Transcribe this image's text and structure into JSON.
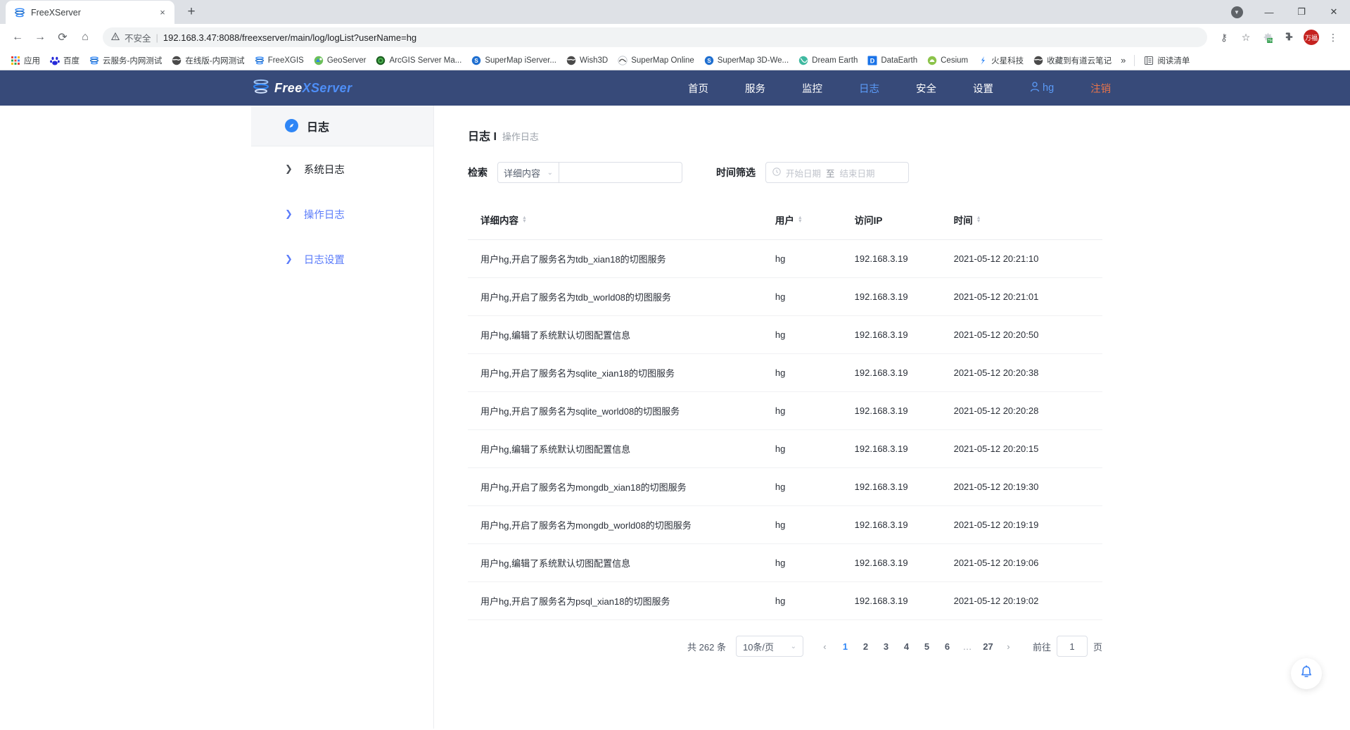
{
  "browser": {
    "tab": {
      "title": "FreeXServer",
      "favicon_name": "freexserver-favicon",
      "close_label": "×"
    },
    "new_tab_label": "+",
    "window_controls": {
      "minimize": "—",
      "maximize": "❐",
      "close": "✕",
      "profile_chevron": "▼"
    },
    "nav": {
      "back": "←",
      "forward": "→",
      "reload": "⟳",
      "home": "⌂"
    },
    "omnibox": {
      "warning_icon": "warning-triangle-icon",
      "security_label": "不安全",
      "separator": "|",
      "url": "192.168.3.47:8088/freexserver/main/log/logList?userName=hg"
    },
    "toolbar_right": {
      "key_icon": "⚷",
      "star_icon": "☆",
      "ext1_icon": "puzzle-ext-icon",
      "ext2_icon": "✦",
      "profile_initials": "万福",
      "menu_icon": "⋮"
    },
    "bookmarks": [
      {
        "label": "应用",
        "icon": "apps-grid-icon"
      },
      {
        "label": "百度",
        "icon": "baidu-icon"
      },
      {
        "label": "云服务-内网测试",
        "icon": "freexserver-icon"
      },
      {
        "label": "在线版-内网测试",
        "icon": "globe-dark-icon"
      },
      {
        "label": "FreeXGIS",
        "icon": "freexserver-icon"
      },
      {
        "label": "GeoServer",
        "icon": "geoserver-icon"
      },
      {
        "label": "ArcGIS Server Ma...",
        "icon": "arcgis-icon"
      },
      {
        "label": "SuperMap iServer...",
        "icon": "supermap-icon"
      },
      {
        "label": "Wish3D",
        "icon": "globe-dark-icon"
      },
      {
        "label": "SuperMap Online",
        "icon": "supermap-online-icon"
      },
      {
        "label": "SuperMap 3D-We...",
        "icon": "supermap-icon"
      },
      {
        "label": "Dream Earth",
        "icon": "dream-earth-icon"
      },
      {
        "label": "DataEarth",
        "icon": "dataearth-icon"
      },
      {
        "label": "Cesium",
        "icon": "cesium-icon"
      },
      {
        "label": "火星科技",
        "icon": "mars-tech-icon"
      },
      {
        "label": "收藏到有道云笔记",
        "icon": "youdao-icon"
      }
    ],
    "bookmarks_overflow": "»",
    "reading_list": {
      "label": "阅读清单",
      "icon": "reading-list-icon"
    }
  },
  "topnav": {
    "logo": {
      "free": "Free",
      "x": "X",
      "server": "Server",
      "icon": "freexserver-logo-icon"
    },
    "items": [
      {
        "label": "首页",
        "state": "normal"
      },
      {
        "label": "服务",
        "state": "normal"
      },
      {
        "label": "监控",
        "state": "normal"
      },
      {
        "label": "日志",
        "state": "active"
      },
      {
        "label": "安全",
        "state": "normal"
      },
      {
        "label": "设置",
        "state": "normal"
      }
    ],
    "user": {
      "label": "hg",
      "icon": "user-person-icon"
    },
    "logout": {
      "label": "注销"
    }
  },
  "sidebar": {
    "header": {
      "label": "日志",
      "icon": "compass-check-icon"
    },
    "items": [
      {
        "label": "系统日志",
        "state": "normal",
        "chevron": "❯"
      },
      {
        "label": "操作日志",
        "state": "link",
        "chevron": "❯"
      },
      {
        "label": "日志设置",
        "state": "link",
        "chevron": "❯"
      }
    ]
  },
  "content": {
    "breadcrumb": {
      "main": "日志 I",
      "sub": "操作日志"
    },
    "filters": {
      "search_label": "检索",
      "select_value": "详细内容",
      "select_chevron": "⌄",
      "search_value": "",
      "search_placeholder": "",
      "time_label": "时间筛选",
      "clock_icon": "clock-icon",
      "date_start_placeholder": "开始日期",
      "date_separator": "至",
      "date_end_placeholder": "结束日期"
    },
    "table": {
      "columns": [
        {
          "label": "详细内容",
          "sortable": true
        },
        {
          "label": "用户",
          "sortable": true
        },
        {
          "label": "访问IP",
          "sortable": false
        },
        {
          "label": "时间",
          "sortable": true
        }
      ],
      "rows": [
        {
          "detail": "用户hg,开启了服务名为tdb_xian18的切图服务",
          "user": "hg",
          "ip": "192.168.3.19",
          "time": "2021-05-12 20:21:10"
        },
        {
          "detail": "用户hg,开启了服务名为tdb_world08的切图服务",
          "user": "hg",
          "ip": "192.168.3.19",
          "time": "2021-05-12 20:21:01"
        },
        {
          "detail": "用户hg,编辑了系统默认切图配置信息",
          "user": "hg",
          "ip": "192.168.3.19",
          "time": "2021-05-12 20:20:50"
        },
        {
          "detail": "用户hg,开启了服务名为sqlite_xian18的切图服务",
          "user": "hg",
          "ip": "192.168.3.19",
          "time": "2021-05-12 20:20:38"
        },
        {
          "detail": "用户hg,开启了服务名为sqlite_world08的切图服务",
          "user": "hg",
          "ip": "192.168.3.19",
          "time": "2021-05-12 20:20:28"
        },
        {
          "detail": "用户hg,编辑了系统默认切图配置信息",
          "user": "hg",
          "ip": "192.168.3.19",
          "time": "2021-05-12 20:20:15"
        },
        {
          "detail": "用户hg,开启了服务名为mongdb_xian18的切图服务",
          "user": "hg",
          "ip": "192.168.3.19",
          "time": "2021-05-12 20:19:30"
        },
        {
          "detail": "用户hg,开启了服务名为mongdb_world08的切图服务",
          "user": "hg",
          "ip": "192.168.3.19",
          "time": "2021-05-12 20:19:19"
        },
        {
          "detail": "用户hg,编辑了系统默认切图配置信息",
          "user": "hg",
          "ip": "192.168.3.19",
          "time": "2021-05-12 20:19:06"
        },
        {
          "detail": "用户hg,开启了服务名为psql_xian18的切图服务",
          "user": "hg",
          "ip": "192.168.3.19",
          "time": "2021-05-12 20:19:02"
        }
      ]
    },
    "pagination": {
      "total_text": "共 262 条",
      "page_size": "10条/页",
      "page_size_chevron": "⌄",
      "prev": "‹",
      "next": "›",
      "pages": [
        "1",
        "2",
        "3",
        "4",
        "5",
        "6"
      ],
      "ellipsis": "…",
      "last_page": "27",
      "current_page": "1",
      "goto_label": "前往",
      "goto_value": "1",
      "goto_unit": "页"
    }
  },
  "floating": {
    "bell": {
      "icon": "bell-icon"
    }
  },
  "colors": {
    "nav_bg": "#374a79",
    "accent_blue": "#2f86f6",
    "link_blue": "#5b7cfa",
    "logout_orange": "#e8744a"
  }
}
